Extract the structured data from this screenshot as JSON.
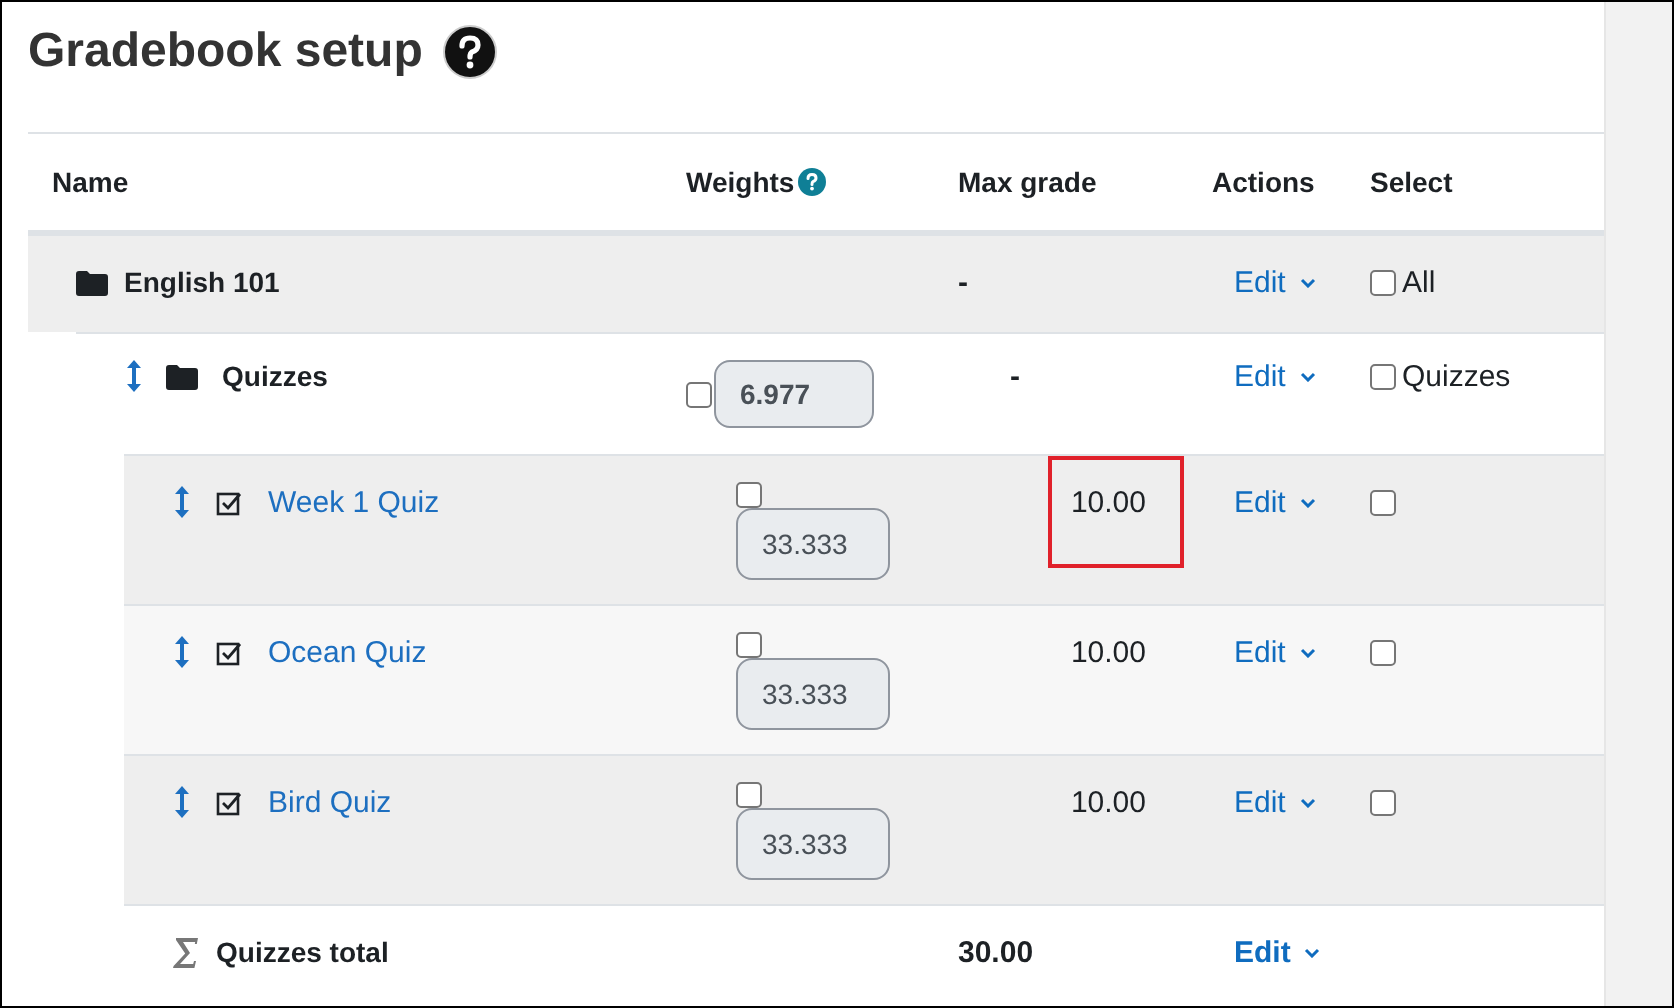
{
  "title": "Gradebook setup",
  "columns": [
    {
      "label": "Name",
      "help": false
    },
    {
      "label": "Weights",
      "help": true
    },
    {
      "label": "Max grade",
      "help": false
    },
    {
      "label": "Actions",
      "help": false
    },
    {
      "label": "Select",
      "help": false
    }
  ],
  "rows": [
    {
      "kind": "category",
      "name": "English 101",
      "max_grade": "-",
      "action": "Edit",
      "select_label": "All",
      "select_checked": false,
      "children": [
        {
          "kind": "category",
          "name": "Quizzes",
          "weight": "6.977",
          "weight_override": false,
          "max_grade": "-",
          "action": "Edit",
          "select_label": "Quizzes",
          "select_checked": false,
          "children": [
            {
              "kind": "item",
              "name": "Week 1 Quiz",
              "weight": "33.333",
              "weight_override": false,
              "max_grade": "10.00",
              "highlighted": true,
              "action": "Edit",
              "select_checked": false
            },
            {
              "kind": "item",
              "name": "Ocean Quiz",
              "weight": "33.333",
              "weight_override": false,
              "max_grade": "10.00",
              "highlighted": false,
              "action": "Edit",
              "select_checked": false
            },
            {
              "kind": "item",
              "name": "Bird Quiz",
              "weight": "33.333",
              "weight_override": false,
              "max_grade": "10.00",
              "highlighted": false,
              "action": "Edit",
              "select_checked": false
            },
            {
              "kind": "total",
              "name": "Quizzes total",
              "max_grade": "30.00",
              "action": "Edit"
            }
          ]
        }
      ]
    }
  ]
}
